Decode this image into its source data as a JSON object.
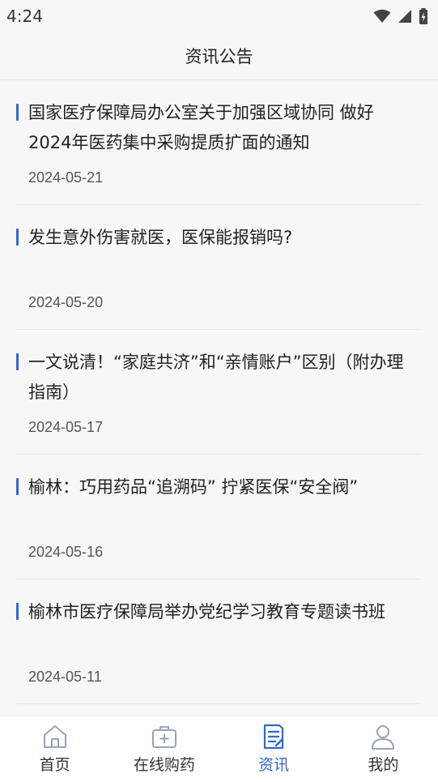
{
  "status": {
    "time": "4:24"
  },
  "header": {
    "title": "资讯公告"
  },
  "articles": [
    {
      "title": "国家医疗保障局办公室关于加强区域协同 做好2024年医药集中采购提质扩面的通知",
      "date": "2024-05-21"
    },
    {
      "title": "发生意外伤害就医，医保能报销吗?",
      "date": "2024-05-20"
    },
    {
      "title": "一文说清！“家庭共济”和“亲情账户”区别（附办理指南）",
      "date": "2024-05-17"
    },
    {
      "title": "榆林：巧用药品“追溯码” 拧紧医保“安全阀”",
      "date": "2024-05-16"
    },
    {
      "title": "榆林市医疗保障局举办党纪学习教育专题读书班",
      "date": "2024-05-11"
    }
  ],
  "tabs": [
    {
      "label": "首页",
      "icon": "home-icon"
    },
    {
      "label": "在线购药",
      "icon": "medkit-icon"
    },
    {
      "label": "资讯",
      "icon": "news-icon",
      "active": true
    },
    {
      "label": "我的",
      "icon": "user-icon"
    }
  ],
  "colors": {
    "accent": "#2f67d8",
    "inactive_icon": "#9aa3b3"
  }
}
